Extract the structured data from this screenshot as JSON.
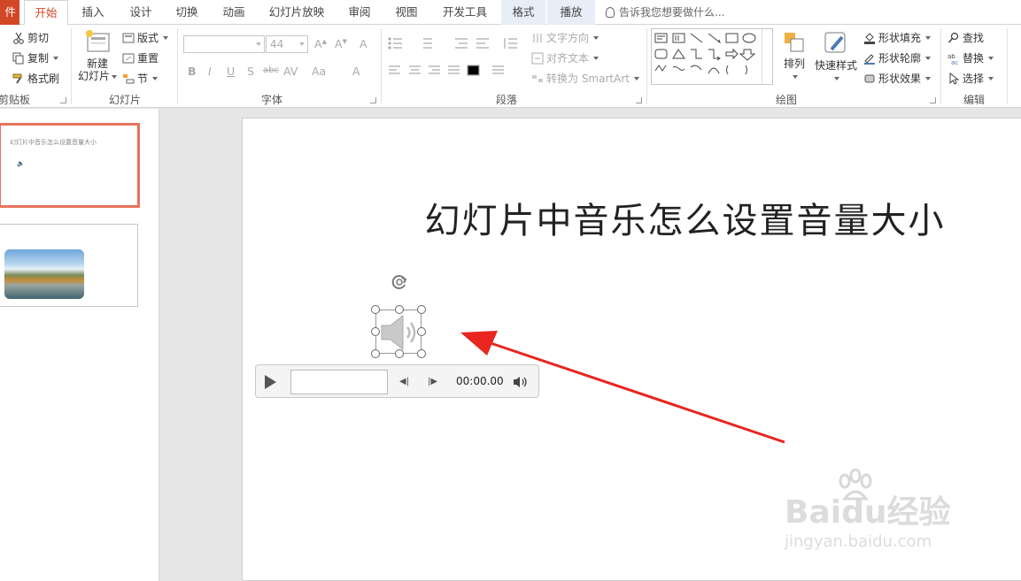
{
  "tabs": {
    "file": "件",
    "home": "开始",
    "insert": "插入",
    "design": "设计",
    "transitions": "切换",
    "animations": "动画",
    "slideshow": "幻灯片放映",
    "review": "审阅",
    "view": "视图",
    "developer": "开发工具",
    "format": "格式",
    "playback": "播放",
    "tell_me": "告诉我您想要做什么..."
  },
  "clipboard": {
    "cut": "剪切",
    "copy": "复制",
    "format_painter": "格式刷",
    "label": "剪贴板"
  },
  "slides_group": {
    "new_slide_line1": "新建",
    "new_slide_line2": "幻灯片",
    "layout": "版式",
    "reset": "重置",
    "section": "节",
    "label": "幻灯片"
  },
  "font": {
    "size": "44",
    "label": "字体"
  },
  "paragraph": {
    "text_direction": "文字方向",
    "align_text": "对齐文本",
    "convert_smartart": "转换为 SmartArt",
    "label": "段落"
  },
  "drawing": {
    "arrange": "排列",
    "quick_styles": "快速样式",
    "shape_fill": "形状填充",
    "shape_outline": "形状轮廓",
    "shape_effects": "形状效果",
    "label": "绘图"
  },
  "editing": {
    "find": "查找",
    "replace": "替换",
    "select": "选择",
    "label": "编辑"
  },
  "thumbnails": {
    "slide1_title": "幻灯片中音乐怎么设置音量大小"
  },
  "slide": {
    "title": "幻灯片中音乐怎么设置音量大小"
  },
  "player": {
    "time": "00:00.00"
  },
  "watermark": {
    "brand": "Baidu经验",
    "url": "jingyan.baidu.com"
  },
  "colors": {
    "accent": "#d24726",
    "arrow": "#e8251f",
    "selected_thumb": "#e8735c"
  }
}
